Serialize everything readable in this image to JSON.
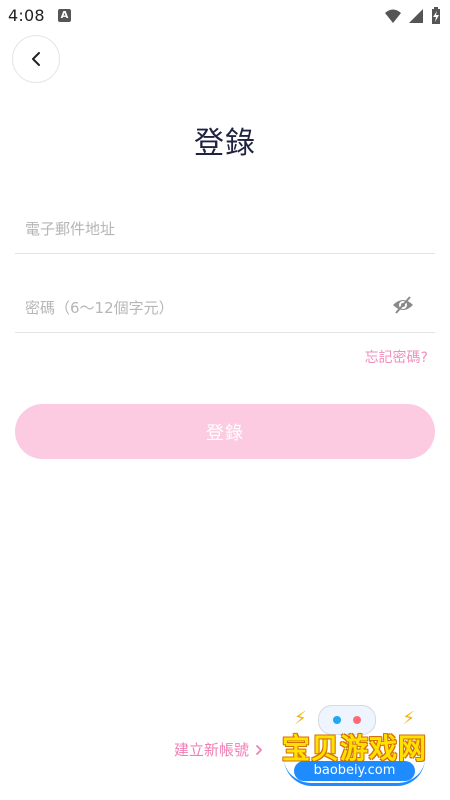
{
  "status_bar": {
    "time": "4:08",
    "app_icon_letter": "A"
  },
  "header": {
    "title": "登錄"
  },
  "form": {
    "email_placeholder": "電子郵件地址",
    "password_placeholder": "密碼（6～12個字元）",
    "forgot_password_label": "忘記密碼?",
    "login_button_label": "登錄"
  },
  "footer": {
    "create_account_label": "建立新帳號"
  },
  "watermark": {
    "text_cn": "宝贝游戏网",
    "url": "baobeiy.com"
  },
  "colors": {
    "accent": "#F08FBC",
    "button_bg": "#FCCBE1",
    "title": "#1F2340",
    "placeholder": "#B6B6B6",
    "divider": "#E3E3E3"
  },
  "icons": {
    "back": "chevron-left-icon",
    "eye": "eye-off-icon",
    "wifi": "wifi-icon",
    "signal": "signal-icon",
    "battery": "battery-charging-icon",
    "create": "chevron-right-icon"
  }
}
